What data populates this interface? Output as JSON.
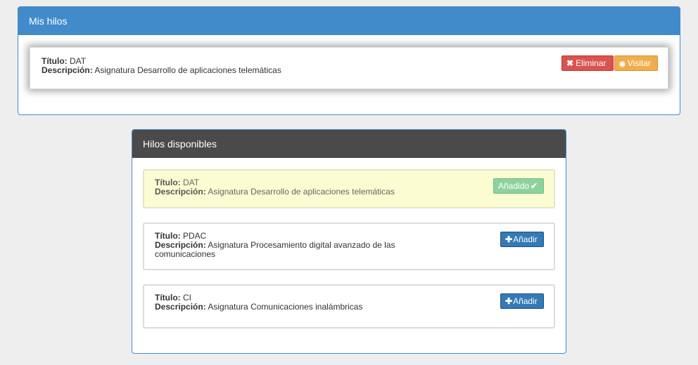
{
  "my_threads": {
    "heading": "Mis hilos",
    "items": [
      {
        "title_label": "Título:",
        "title": "DAT",
        "desc_label": "Descripción:",
        "desc": "Asignatura Desarrollo de aplicaciones telemáticas",
        "delete_label": "Eliminar",
        "delete_icon": "times-icon",
        "visit_label": "Visitar",
        "visit_icon": "camera-icon"
      }
    ]
  },
  "available_threads": {
    "heading": "Hilos disponibles",
    "items": [
      {
        "title_label": "Título:",
        "title": "DAT",
        "desc_label": "Descripción:",
        "desc": "Asignatura Desarrollo de aplicaciones telemáticas",
        "status": "added",
        "button_label": "Añadido",
        "button_icon": "check-icon"
      },
      {
        "title_label": "Título:",
        "title": "PDAC",
        "desc_label": "Descripción:",
        "desc": "Asignatura Procesamiento digital avanzado de las comunicaciones",
        "status": "available",
        "button_label": "Añadir",
        "button_icon": "plus-icon"
      },
      {
        "title_label": "Título:",
        "title": "CI",
        "desc_label": "Descripción:",
        "desc": "Asignatura Comunicaciones inalámbricas",
        "status": "available",
        "button_label": "Añadir",
        "button_icon": "plus-icon"
      }
    ]
  },
  "colors": {
    "primary": "#428bca",
    "dark_heading": "#4a4a4a",
    "danger": "#d9534f",
    "warning": "#f0ad4e",
    "added_bg": "#fcfcd2",
    "success": "#8fd19e"
  }
}
